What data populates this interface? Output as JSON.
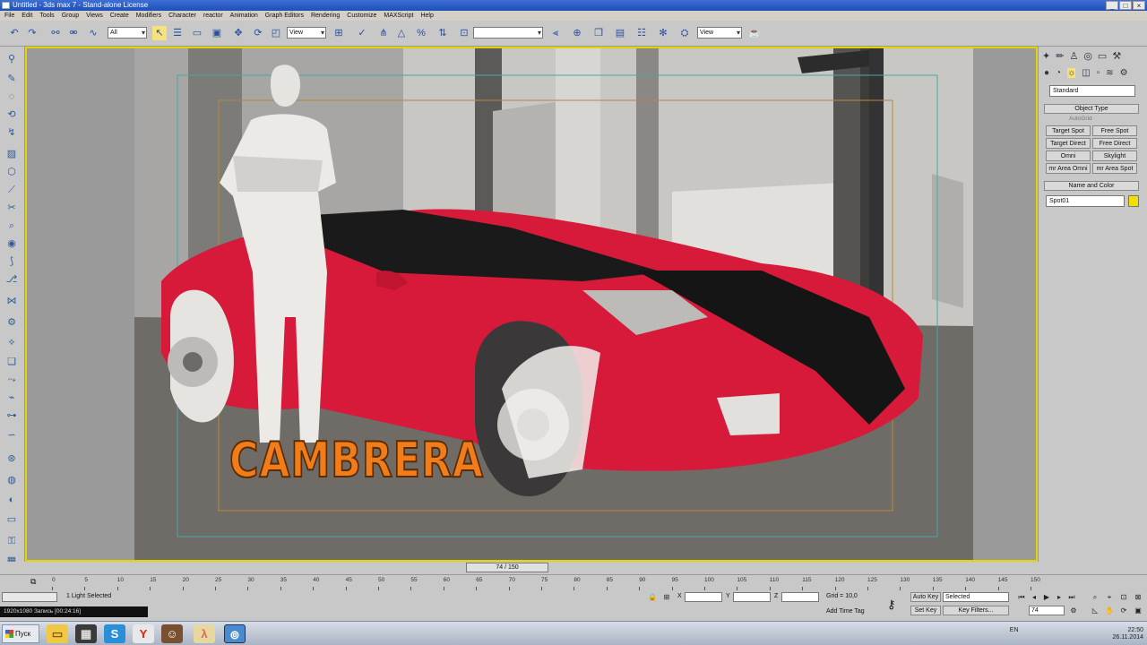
{
  "window": {
    "title": "Untitled - 3ds max 7 - Stand-alone License",
    "buttons": [
      "_",
      "□",
      "×"
    ]
  },
  "menu": [
    "File",
    "Edit",
    "Tools",
    "Group",
    "Views",
    "Create",
    "Modifiers",
    "Character",
    "reactor",
    "Animation",
    "Graph Editors",
    "Rendering",
    "Customize",
    "MAXScript",
    "Help"
  ],
  "toolbar": {
    "selection_filter": "All",
    "ref_coord": "View",
    "named_sel": "",
    "view2": "View"
  },
  "command_panel": {
    "category": "Standard",
    "rollout_object_type": "Object Type",
    "autogrid": "AutoGrid",
    "buttons": [
      "Target Spot",
      "Free Spot",
      "Target Direct",
      "Free Direct",
      "Omni",
      "Skylight",
      "mr Area Omni",
      "mr Area Spot"
    ],
    "rollout_name_color": "Name and Color",
    "object_name": "Spot01",
    "swatch_color": "#f2e000"
  },
  "viewport": {
    "watermark": "CAMBRERA",
    "car_color": "#d81a3a",
    "stripe_color": "#151515",
    "border_color": "#e6d400"
  },
  "timeslider": {
    "label": "74 / 150"
  },
  "trackbar": {
    "ticks": [
      "0",
      "5",
      "10",
      "15",
      "20",
      "25",
      "30",
      "35",
      "40",
      "45",
      "50",
      "55",
      "60",
      "65",
      "70",
      "75",
      "80",
      "85",
      "90",
      "95",
      "100",
      "105",
      "110",
      "115",
      "120",
      "125",
      "130",
      "135",
      "140",
      "145",
      "150"
    ]
  },
  "status": {
    "selection": "1 Light Selected",
    "x_label": "X",
    "y_label": "Y",
    "z_label": "Z",
    "grid": "Grid = 10,0",
    "add_time_tag": "Add Time Tag",
    "auto_key": "Auto Key",
    "set_key": "Set Key",
    "key_mode": "Selected",
    "key_filters": "Key Filters...",
    "frame": "74"
  },
  "recorder": {
    "text": "1920x1080   Запись [00:24:16]"
  },
  "taskbar": {
    "start": "Пуск",
    "lang": "EN",
    "time": "22:50",
    "date": "26.11.2014"
  }
}
